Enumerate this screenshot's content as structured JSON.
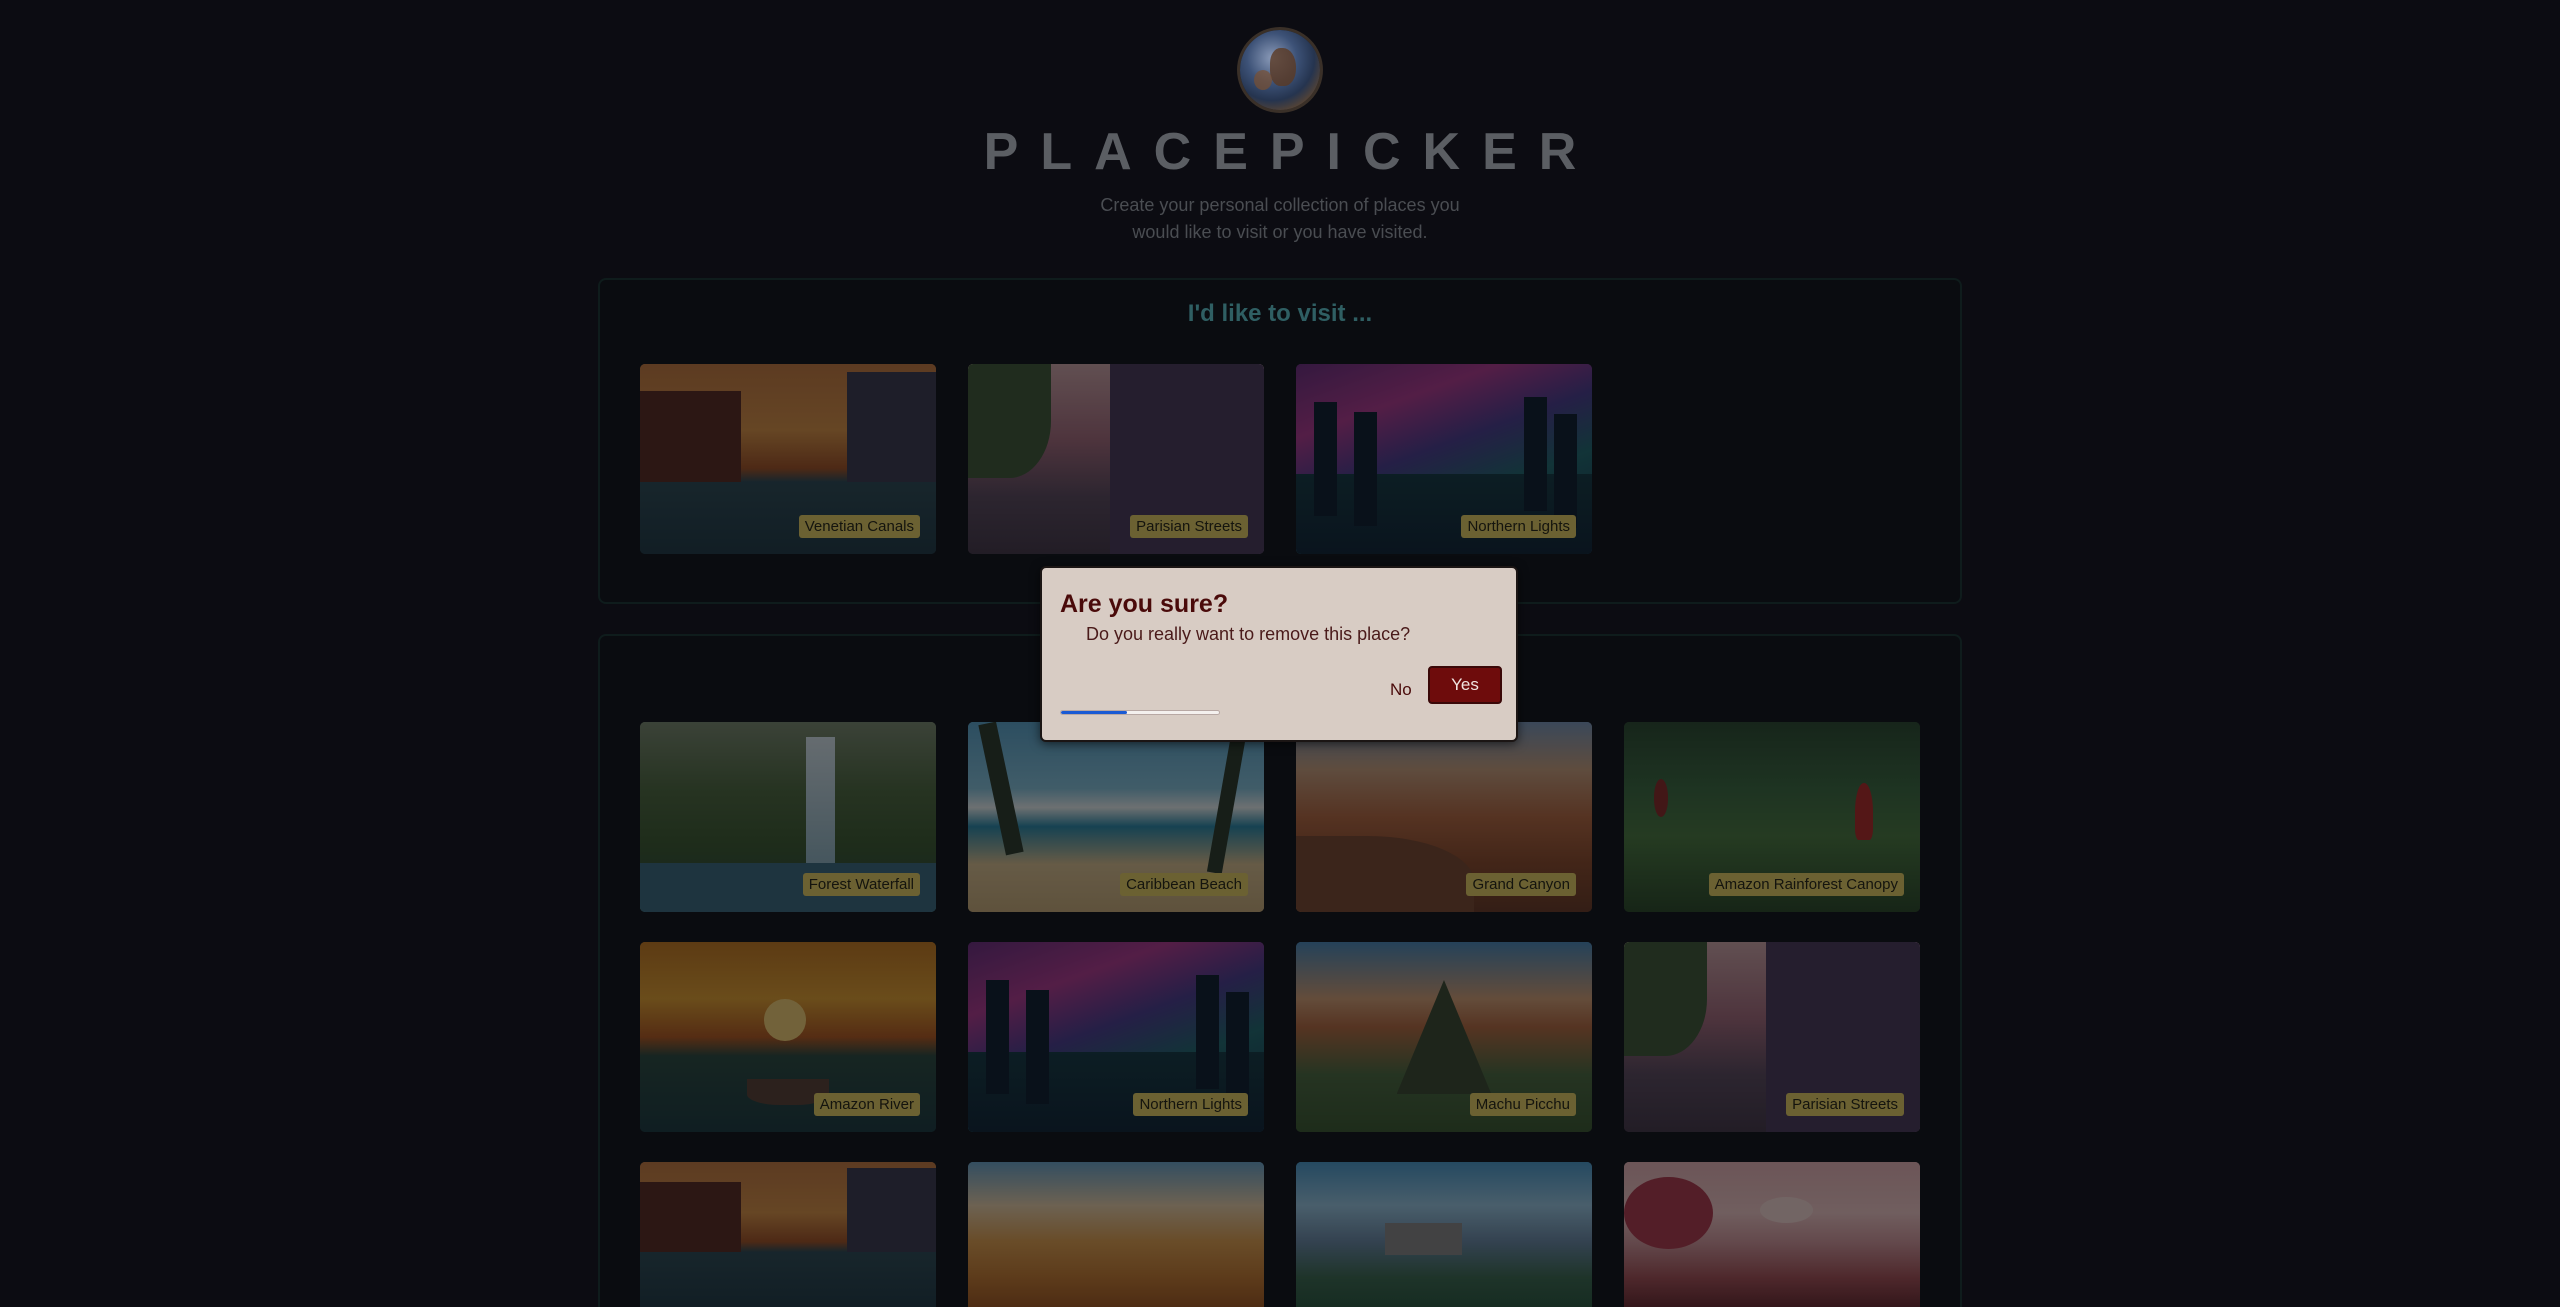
{
  "header": {
    "title": "PLACEPICKER",
    "subtitle": "Create your personal collection of places you would like to visit or you have visited."
  },
  "sections": {
    "wishlist": {
      "title": "I'd like to visit ...",
      "places": [
        {
          "label": "Venetian Canals"
        },
        {
          "label": "Parisian Streets"
        },
        {
          "label": "Northern Lights"
        }
      ]
    },
    "available": {
      "places": [
        {
          "label": "Forest Waterfall"
        },
        {
          "label": "Caribbean Beach"
        },
        {
          "label": "Grand Canyon"
        },
        {
          "label": "Amazon Rainforest Canopy"
        },
        {
          "label": "Amazon River"
        },
        {
          "label": "Northern Lights"
        },
        {
          "label": "Machu Picchu"
        },
        {
          "label": "Parisian Streets"
        }
      ]
    }
  },
  "modal": {
    "title": "Are you sure?",
    "text": "Do you really want to remove this place?",
    "no_label": "No",
    "yes_label": "Yes",
    "progress_fraction": 0.42
  },
  "colors": {
    "modal_bg": "#d8ccc4",
    "yes_button": "#6e0c0c",
    "progress": "#1a5ad4",
    "section_title": "#2f5f63"
  }
}
